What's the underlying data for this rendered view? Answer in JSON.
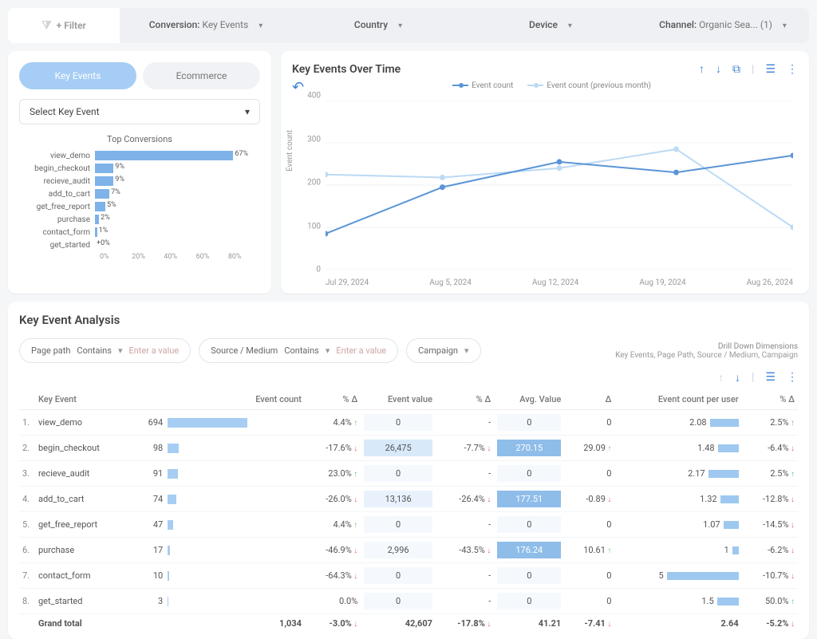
{
  "filters": {
    "btn_label": "+ Filter",
    "conversion": {
      "label": "Conversion:",
      "value": "Key Events"
    },
    "country": {
      "label": "Country"
    },
    "device": {
      "label": "Device"
    },
    "channel": {
      "label": "Channel:",
      "value": "Organic Sea... (1)"
    }
  },
  "sidecard": {
    "tab_events": "Key Events",
    "tab_ecom": "Ecommerce",
    "select_placeholder": "Select Key Event",
    "top_title": "Top Conversions",
    "axis": [
      "0%",
      "20%",
      "40%",
      "60%",
      "80%"
    ]
  },
  "chart_data": {
    "top_conversions": {
      "type": "bar",
      "title": "Top Conversions",
      "xlim": [
        0,
        80
      ],
      "xlabel": "%",
      "bars": [
        {
          "name": "view_demo",
          "pct": 67
        },
        {
          "name": "begin_checkout",
          "pct": 9
        },
        {
          "name": "recieve_audit",
          "pct": 9
        },
        {
          "name": "add_to_cart",
          "pct": 7
        },
        {
          "name": "get_free_report",
          "pct": 5
        },
        {
          "name": "purchase",
          "pct": 2
        },
        {
          "name": "contact_form",
          "pct": 1
        },
        {
          "name": "get_started",
          "pct": 0,
          "pct_label": "+0%"
        }
      ]
    },
    "events_over_time": {
      "type": "line",
      "title": "Key Events Over Time",
      "ylabel": "Event count",
      "ylim": [
        0,
        400
      ],
      "yticks": [
        0,
        100,
        200,
        300,
        400
      ],
      "x": [
        "Jul 29, 2024",
        "Aug 5, 2024",
        "Aug 12, 2024",
        "Aug 19, 2024",
        "Aug 26, 2024"
      ],
      "series": [
        {
          "name": "Event count",
          "color": "#5b95d6",
          "values": [
            85,
            195,
            255,
            230,
            270
          ]
        },
        {
          "name": "Event count (previous month)",
          "color": "#bcdaf4",
          "values": [
            225,
            218,
            240,
            285,
            100
          ]
        }
      ]
    }
  },
  "linecard": {
    "title": "Key Events Over Time",
    "legend_a": "Event count",
    "legend_b": "Event count (previous month)",
    "ylabel": "Event count"
  },
  "analysis": {
    "title": "Key Event Analysis",
    "f1_label": "Page path",
    "f2_label": "Source / Medium",
    "f3_label": "Campaign",
    "contains": "Contains",
    "placeholder": "Enter a value",
    "drill_title": "Drill Down Dimensions",
    "drill_sub": "Key Events, Page Path, Source / Medium, Campaign",
    "cols": [
      "",
      "Key Event",
      "Event count",
      "% Δ",
      "Event value",
      "% Δ",
      "Avg. Value",
      "Δ",
      "Event count per user",
      "% Δ"
    ],
    "rows": [
      {
        "n": "1.",
        "key": "view_demo",
        "cnt": 694,
        "bar": 100,
        "d1": "4.4%",
        "d1c": "up",
        "val": "0",
        "d2": "-",
        "avg": "0",
        "d3": "0",
        "u": 2.08,
        "ub": 36,
        "d4": "2.5%",
        "d4c": "up",
        "valcls": "val-box-low",
        "avgcls": "val-box-low"
      },
      {
        "n": "2.",
        "key": "begin_checkout",
        "cnt": 98,
        "bar": 14,
        "d1": "-17.6%",
        "d1c": "down",
        "val": "26,475",
        "d2": "-7.7%",
        "d2c": "down",
        "avg": "270.15",
        "d3": "29.09",
        "d3c": "up",
        "u": 1.48,
        "ub": 26,
        "d4": "-6.4%",
        "d4c": "down",
        "valcls": "val-box-1",
        "avgcls": "val-box-2"
      },
      {
        "n": "3.",
        "key": "recieve_audit",
        "cnt": 91,
        "bar": 13,
        "d1": "23.0%",
        "d1c": "up",
        "val": "0",
        "d2": "-",
        "avg": "0",
        "d3": "0",
        "u": 2.17,
        "ub": 38,
        "d4": "2.5%",
        "d4c": "up",
        "valcls": "val-box-low",
        "avgcls": "val-box-low"
      },
      {
        "n": "4.",
        "key": "add_to_cart",
        "cnt": 74,
        "bar": 11,
        "d1": "-26.0%",
        "d1c": "down",
        "val": "13,136",
        "d2": "-26.4%",
        "d2c": "down",
        "avg": "177.51",
        "d3": "-0.89",
        "d3c": "down",
        "u": 1.32,
        "ub": 23,
        "d4": "-12.8%",
        "d4c": "down",
        "valcls": "val-box-3",
        "avgcls": "val-box-2"
      },
      {
        "n": "5.",
        "key": "get_free_report",
        "cnt": 47,
        "bar": 7,
        "d1": "4.4%",
        "d1c": "up",
        "val": "0",
        "d2": "-",
        "avg": "0",
        "d3": "0",
        "u": 1.07,
        "ub": 19,
        "d4": "-14.5%",
        "d4c": "down",
        "valcls": "val-box-low",
        "avgcls": "val-box-low"
      },
      {
        "n": "6.",
        "key": "purchase",
        "cnt": 17,
        "bar": 3,
        "d1": "-46.9%",
        "d1c": "down",
        "val": "2,996",
        "d2": "-43.5%",
        "d2c": "down",
        "avg": "176.24",
        "d3": "10.61",
        "d3c": "up",
        "u": 1,
        "ub": 8,
        "d4": "-6.2%",
        "d4c": "down",
        "valcls": "val-box-low",
        "avgcls": "val-box-2"
      },
      {
        "n": "7.",
        "key": "contact_form",
        "cnt": 10,
        "bar": 2,
        "d1": "-64.3%",
        "d1c": "down",
        "val": "0",
        "d2": "-",
        "avg": "0",
        "d3": "0",
        "u": 5,
        "ub": 90,
        "d4": "-10.7%",
        "d4c": "down",
        "valcls": "val-box-low",
        "avgcls": "val-box-low"
      },
      {
        "n": "8.",
        "key": "get_started",
        "cnt": 3,
        "bar": 1,
        "d1": "0.0%",
        "d1c": "",
        "val": "0",
        "d2": "-",
        "avg": "0",
        "d3": "0",
        "u": 1.5,
        "ub": 27,
        "d4": "50.0%",
        "d4c": "up",
        "valcls": "val-box-low",
        "avgcls": "val-box-low"
      }
    ],
    "total": {
      "label": "Grand total",
      "cnt": "1,034",
      "d1": "-3.0%",
      "d1c": "down",
      "val": "42,607",
      "d2": "-17.8%",
      "d2c": "down",
      "avg": "41.21",
      "d3": "-7.41",
      "d3c": "down",
      "u": "2.64",
      "d4": "-5.2%",
      "d4c": "down"
    }
  }
}
